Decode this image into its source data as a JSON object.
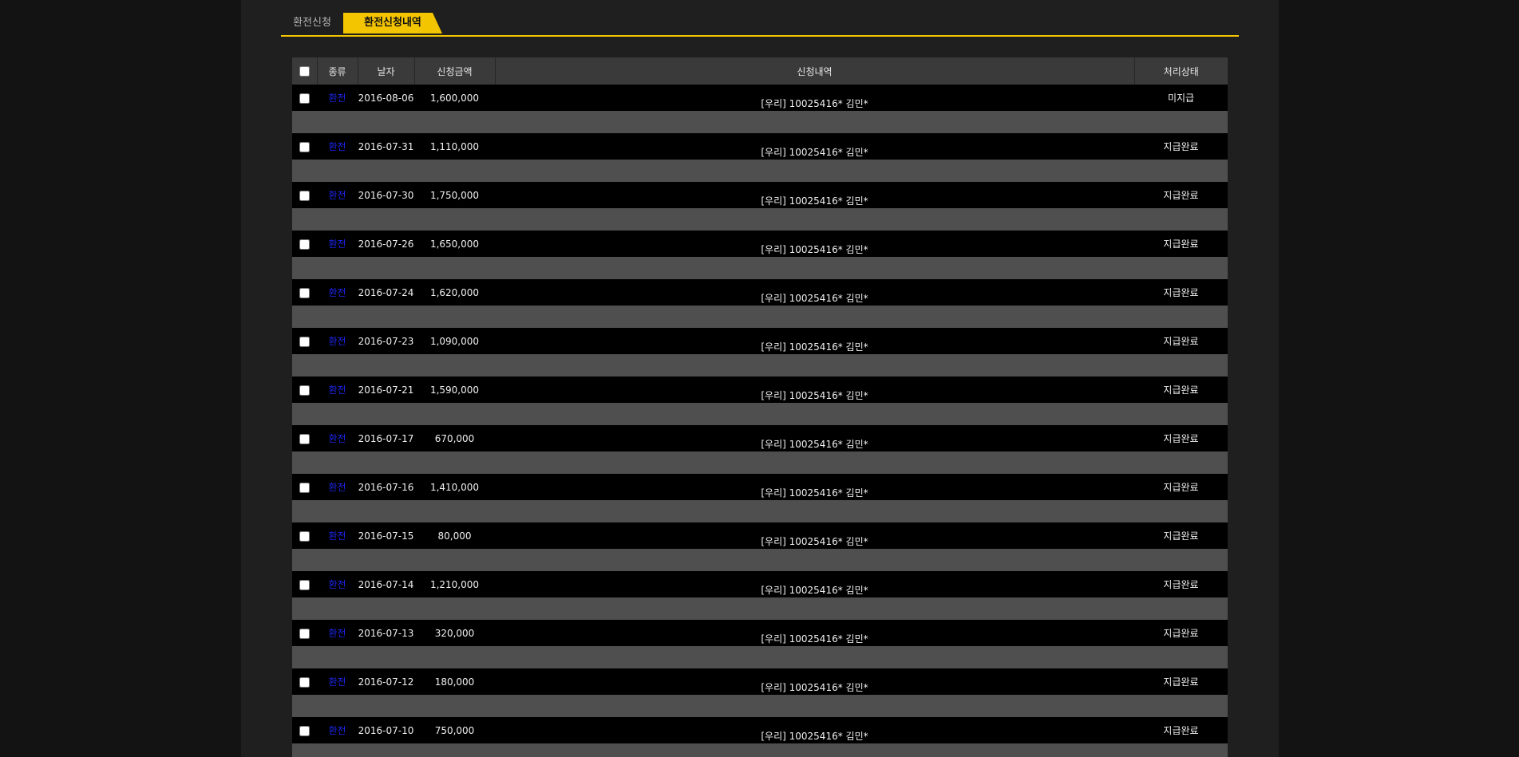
{
  "tabs": [
    {
      "label": "환전신청",
      "active": false
    },
    {
      "label": "환전신청내역",
      "active": true
    }
  ],
  "table": {
    "headers": {
      "kind": "종류",
      "date": "날자",
      "amount": "신청금액",
      "detail": "신청내역",
      "status": "처리상태"
    },
    "rows": [
      {
        "kind": "환전",
        "date": "2016-08-06",
        "amount": "1,600,000",
        "detail": "[우리] 10025416* 김민*",
        "status": "미지급"
      },
      {
        "kind": "환전",
        "date": "2016-07-31",
        "amount": "1,110,000",
        "detail": "[우리] 10025416* 김민*",
        "status": "지급완료"
      },
      {
        "kind": "환전",
        "date": "2016-07-30",
        "amount": "1,750,000",
        "detail": "[우리] 10025416* 김민*",
        "status": "지급완료"
      },
      {
        "kind": "환전",
        "date": "2016-07-26",
        "amount": "1,650,000",
        "detail": "[우리] 10025416* 김민*",
        "status": "지급완료"
      },
      {
        "kind": "환전",
        "date": "2016-07-24",
        "amount": "1,620,000",
        "detail": "[우리] 10025416* 김민*",
        "status": "지급완료"
      },
      {
        "kind": "환전",
        "date": "2016-07-23",
        "amount": "1,090,000",
        "detail": "[우리] 10025416* 김민*",
        "status": "지급완료"
      },
      {
        "kind": "환전",
        "date": "2016-07-21",
        "amount": "1,590,000",
        "detail": "[우리] 10025416* 김민*",
        "status": "지급완료"
      },
      {
        "kind": "환전",
        "date": "2016-07-17",
        "amount": "670,000",
        "detail": "[우리] 10025416* 김민*",
        "status": "지급완료"
      },
      {
        "kind": "환전",
        "date": "2016-07-16",
        "amount": "1,410,000",
        "detail": "[우리] 10025416* 김민*",
        "status": "지급완료"
      },
      {
        "kind": "환전",
        "date": "2016-07-15",
        "amount": "80,000",
        "detail": "[우리] 10025416* 김민*",
        "status": "지급완료"
      },
      {
        "kind": "환전",
        "date": "2016-07-14",
        "amount": "1,210,000",
        "detail": "[우리] 10025416* 김민*",
        "status": "지급완료"
      },
      {
        "kind": "환전",
        "date": "2016-07-13",
        "amount": "320,000",
        "detail": "[우리] 10025416* 김민*",
        "status": "지급완료"
      },
      {
        "kind": "환전",
        "date": "2016-07-12",
        "amount": "180,000",
        "detail": "[우리] 10025416* 김민*",
        "status": "지급완료"
      },
      {
        "kind": "환전",
        "date": "2016-07-10",
        "amount": "750,000",
        "detail": "[우리] 10025416* 김민*",
        "status": "지급완료"
      }
    ]
  },
  "colors": {
    "accent": "#f3c400",
    "link": "#1c24e8",
    "row_bg": "#000000",
    "spacer_bg": "#4f4f4f",
    "header_bg": "#3a3a3a"
  }
}
